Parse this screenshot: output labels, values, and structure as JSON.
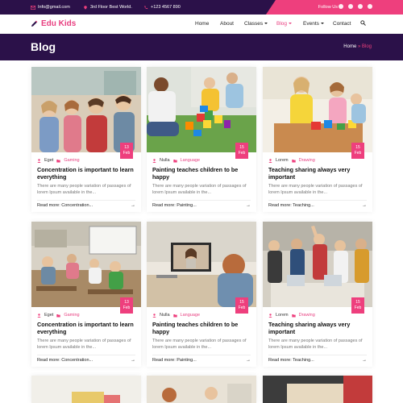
{
  "topbar": {
    "email": "Info@gmail.com",
    "address": "3rd Floor Best World.",
    "phone": "+123 4567 890",
    "follow_label": "Follow Us :",
    "social_icons": [
      "facebook-icon",
      "twitter-icon",
      "instagram-icon",
      "pinterest-icon"
    ]
  },
  "header": {
    "logo_text": "Edu Kids",
    "nav": {
      "home": "Home",
      "about": "About",
      "classes": "Classes",
      "blog": "Blog",
      "events": "Events",
      "contact": "Contact"
    }
  },
  "banner": {
    "title": "Blog",
    "breadcrumb_home": "Home",
    "breadcrumb_sep": "»",
    "breadcrumb_current": "Blog"
  },
  "cards": [
    {
      "day": "13",
      "month": "Feb",
      "author": "Eget",
      "category": "Gaming",
      "title": "Concentration is important to learn everything",
      "excerpt": "There are many people variation of passages of lorem Ipsum available in the...",
      "read_more": "Read more: Concentration..."
    },
    {
      "day": "15",
      "month": "Feb",
      "author": "Nulla",
      "category": "Language",
      "title": "Painting teaches children to be happy",
      "excerpt": "There are many people variation of passages of lorem Ipsum available in the...",
      "read_more": "Read more: Painting..."
    },
    {
      "day": "15",
      "month": "Feb",
      "author": "Lorem",
      "category": "Drawing",
      "title": "Teaching sharing always very important",
      "excerpt": "There are many people variation of passages of lorem Ipsum available in the...",
      "read_more": "Read more: Teaching..."
    },
    {
      "day": "13",
      "month": "Feb",
      "author": "Eget",
      "category": "Gaming",
      "title": "Concentration is important to learn everything",
      "excerpt": "There are many people variation of passages of lorem Ipsum available in the...",
      "read_more": "Read more: Concentration..."
    },
    {
      "day": "15",
      "month": "Feb",
      "author": "Nulla",
      "category": "Language",
      "title": "Painting teaches children to be happy",
      "excerpt": "There are many people variation of passages of lorem Ipsum available in the...",
      "read_more": "Read more: Painting..."
    },
    {
      "day": "15",
      "month": "Feb",
      "author": "Lorem",
      "category": "Drawing",
      "title": "Teaching sharing always very important",
      "excerpt": "There are many people variation of passages of lorem Ipsum available in the...",
      "read_more": "Read more: Teaching..."
    }
  ],
  "colors": {
    "brand_purple": "#2b1149",
    "accent_pink": "#ee3f7d"
  }
}
